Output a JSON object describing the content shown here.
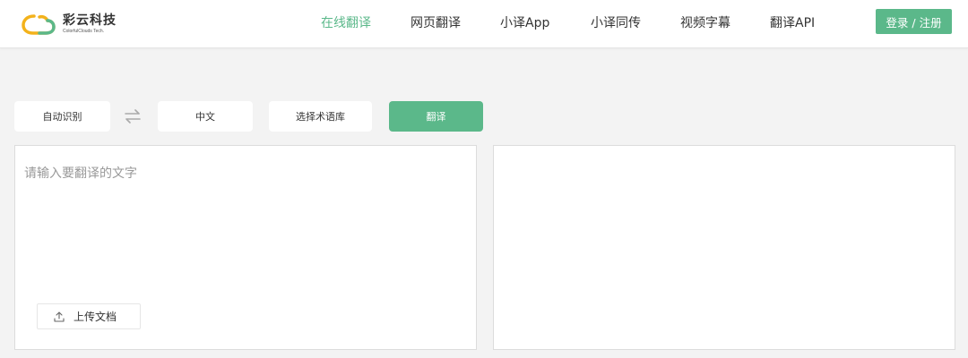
{
  "brand": {
    "name_cn": "彩云科技",
    "name_en": "ColorfulClouds Tech.",
    "logo_colors": [
      "#f3b21b",
      "#5bb88a"
    ]
  },
  "nav": {
    "items": [
      {
        "label": "在线翻译",
        "active": true
      },
      {
        "label": "网页翻译",
        "active": false
      },
      {
        "label": "小译App",
        "active": false
      },
      {
        "label": "小译同传",
        "active": false
      },
      {
        "label": "视频字幕",
        "active": false
      },
      {
        "label": "翻译API",
        "active": false
      }
    ],
    "login_label": "登录 / 注册"
  },
  "toolbar": {
    "source_lang": "自动识别",
    "swap_icon": "swap-arrows-icon",
    "target_lang": "中文",
    "glossary_label": "选择术语库",
    "translate_label": "翻译"
  },
  "editor": {
    "placeholder": "请输入要翻译的文字",
    "upload_label": "上传文档",
    "upload_icon": "upload-icon"
  },
  "colors": {
    "accent": "#5bb88a",
    "background": "#f3f3f3"
  }
}
